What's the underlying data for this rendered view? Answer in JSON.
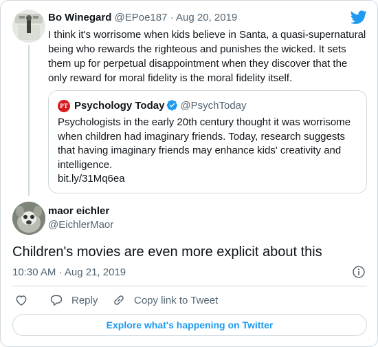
{
  "parent_tweet": {
    "name": "Bo Winegard",
    "handle": "@EPoe187",
    "separator": "·",
    "date": "Aug 20, 2019",
    "text": "I think it's worrisome when kids believe in Santa, a quasi-supernatural being who rewards the righteous and punishes the wicked. It sets them up for perpetual disappointment when they discover that the only reward for moral fidelity is the moral fidelity itself."
  },
  "quoted_tweet": {
    "logo_text": "PT",
    "name": "Psychology Today",
    "handle": "@PsychToday",
    "text": "Psychologists in the early 20th century thought it was worrisome when children had imaginary friends. Today, research suggests that having imaginary friends may enhance kids' creativity and intelligence.",
    "link": "bit.ly/31Mq6ea"
  },
  "main_tweet": {
    "name": "maor eichler",
    "handle": "@EichlerMaor",
    "text": "Children's movies are even more explicit about this",
    "timestamp": "10:30 AM · Aug 21, 2019"
  },
  "actions": {
    "reply_label": "Reply",
    "copy_link_label": "Copy link to Tweet"
  },
  "explore_label": "Explore what's happening on Twitter",
  "colors": {
    "accent": "#1d9bf0",
    "muted_text": "#536471",
    "border": "#cfd9de",
    "psychology_today_red": "#d91c20"
  },
  "icons": [
    "twitter-bird-icon",
    "verified-badge-icon",
    "info-icon",
    "heart-icon",
    "reply-bubble-icon",
    "link-icon"
  ]
}
